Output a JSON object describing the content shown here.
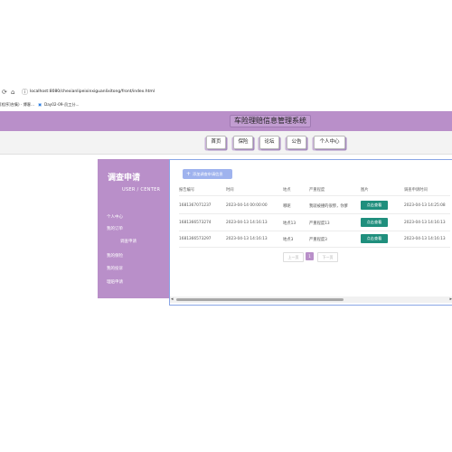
{
  "browser": {
    "url": "localhost:8080/chexianlipeixinxiguanlixitong/front/index.html",
    "bookmarks": [
      "[程序]合集) · 博客...",
      "Day02-09-员工分..."
    ]
  },
  "header": {
    "title": "车险理赔信息管理系统",
    "nav": [
      "首页",
      "保险",
      "论坛",
      "公告",
      "个人中心"
    ]
  },
  "sidebar": {
    "title": "调查申请",
    "subtitle": "USER / CENTER",
    "items": [
      "个人中心",
      "我的订单",
      "调查申请",
      "我的保险",
      "我的投诉",
      "理赔申请"
    ]
  },
  "main": {
    "add_button": "添加调查申请信息",
    "columns": [
      "报告编号",
      "时间",
      "地点",
      "严重程度",
      "图片",
      "调查申请时间"
    ],
    "rows": [
      {
        "id": "1681367071237",
        "time": "2023-04-14 00:00:00",
        "place": "哪呢",
        "severity": "我就被撞的很惨，你爹",
        "action": "点击查看",
        "applied": "2023-04-13 14:25:08"
      },
      {
        "id": "1681366573274",
        "time": "2023-04-13 14:16:13",
        "place": "地点13",
        "severity": "严重程度13",
        "action": "点击查看",
        "applied": "2023-04-13 14:16:13"
      },
      {
        "id": "1681366573297",
        "time": "2023-04-13 14:16:13",
        "place": "地点3",
        "severity": "严重程度3",
        "action": "点击查看",
        "applied": "2023-04-13 14:16:13"
      }
    ],
    "pager": {
      "prev": "上一页",
      "current": "1",
      "next": "下一页"
    }
  },
  "colors": {
    "accent": "#b98fc9",
    "button_teal": "#1f8f7d",
    "add_button": "#9fb3ee"
  }
}
